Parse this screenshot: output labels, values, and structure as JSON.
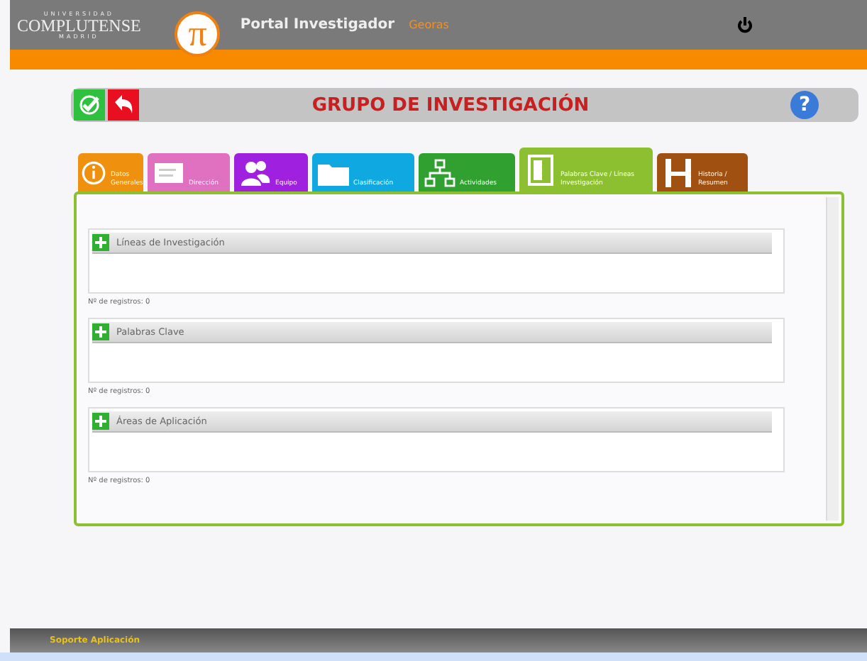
{
  "header": {
    "university": "COMPLUTENSE",
    "university_top": "UNIVERSIDAD",
    "university_bottom": "MADRID",
    "logo_symbol": "π",
    "app_title": "Portal Investigador",
    "user": "Georas"
  },
  "page_title": "GRUPO DE INVESTIGACIÓN",
  "help_symbol": "?",
  "tabs": [
    {
      "label": "Datos Generales",
      "kind": "info",
      "color": "#f0900f",
      "selected": false
    },
    {
      "label": "Dirección",
      "kind": "card",
      "color": "#e070c0",
      "selected": false
    },
    {
      "label": "Equipo",
      "kind": "people",
      "color": "#a020e0",
      "selected": false
    },
    {
      "label": "Clasificación",
      "kind": "folder",
      "color": "#10a8e0",
      "selected": false
    },
    {
      "label": "Actividades",
      "kind": "tree",
      "color": "#30a030",
      "selected": false
    },
    {
      "label": "Palabras Clave / Líneas Investigación",
      "kind": "book",
      "color": "#8cc030",
      "selected": true
    },
    {
      "label": "Historia / Resumen",
      "kind": "letter",
      "color": "#a05010",
      "selected": false
    }
  ],
  "sections": [
    {
      "title": "Líneas de Investigación",
      "count": "Nº de registros: 0"
    },
    {
      "title": "Palabras Clave",
      "count": "Nº de registros: 0"
    },
    {
      "title": "Áreas de Aplicación",
      "count": "Nº de registros: 0"
    }
  ],
  "footer": {
    "support": "Soporte Aplicación"
  }
}
